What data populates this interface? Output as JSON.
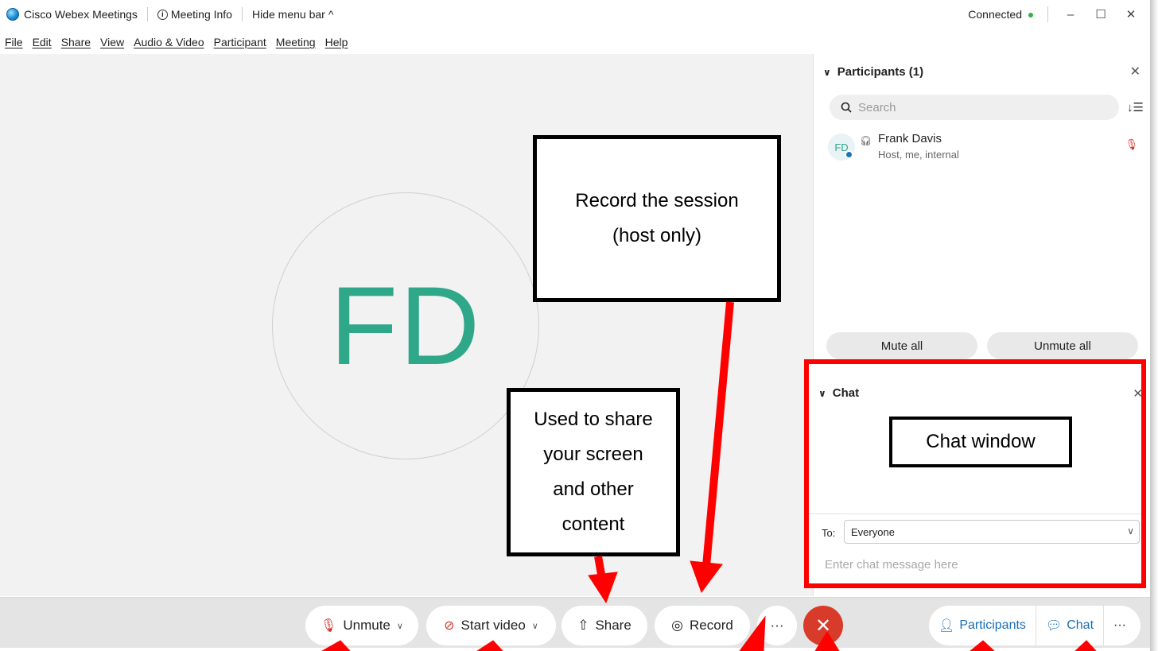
{
  "titlebar": {
    "app_name": "Cisco Webex Meetings",
    "meeting_info": "Meeting Info",
    "hide_menu": "Hide menu bar",
    "status": "Connected"
  },
  "menu": [
    "File",
    "Edit",
    "Share",
    "View",
    "Audio & Video",
    "Participant",
    "Meeting",
    "Help"
  ],
  "stage": {
    "initials": "FD"
  },
  "participants_panel": {
    "title": "Participants (1)",
    "search_placeholder": "Search",
    "participant": {
      "initials": "FD",
      "name": "Frank Davis",
      "role": "Host, me, internal"
    },
    "mute_all": "Mute all",
    "unmute_all": "Unmute all"
  },
  "chat_panel": {
    "title": "Chat",
    "to_label": "To:",
    "to_value": "Everyone",
    "input_placeholder": "Enter chat message here"
  },
  "toolbar": {
    "unmute": "Unmute",
    "start_video": "Start video",
    "share": "Share",
    "record": "Record",
    "more": "···",
    "participants": "Participants",
    "chat": "Chat"
  },
  "callouts": {
    "record": [
      "Record the session",
      "(host only)"
    ],
    "share": [
      "Used to share",
      "your screen",
      "and other",
      "content"
    ],
    "chat": "Chat window"
  },
  "colors": {
    "annotation_red": "#ff0000",
    "accent_teal": "#2fa88a",
    "leave_red": "#d93b2b",
    "link_blue": "#1a6fb5"
  }
}
